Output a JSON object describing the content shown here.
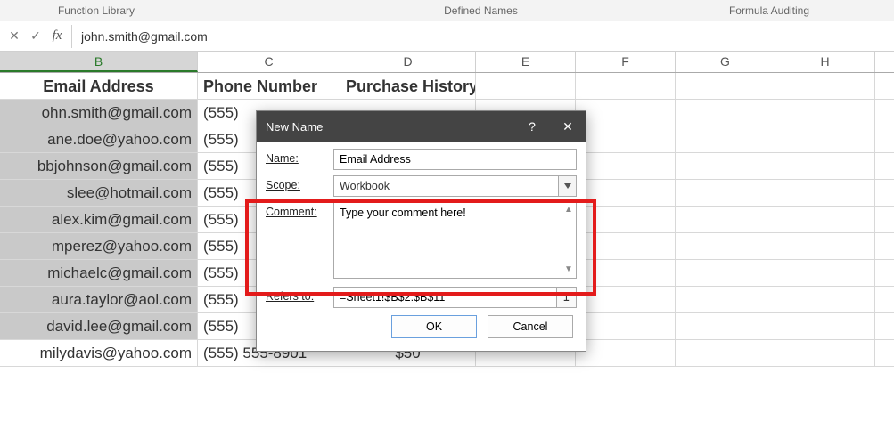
{
  "ribbon_groups": {
    "function_library": "Function Library",
    "defined_names": "Defined Names",
    "formula_auditing": "Formula Auditing"
  },
  "formula_bar": {
    "cancel_glyph": "✕",
    "accept_glyph": "✓",
    "fx_label": "fx",
    "value": "john.smith@gmail.com"
  },
  "columns": [
    "B",
    "C",
    "D",
    "E",
    "F",
    "G",
    "H"
  ],
  "selected_column": "B",
  "header_row": {
    "B": "Email Address",
    "C": "Phone Number",
    "D": "Purchase History"
  },
  "data_rows": [
    {
      "B": "ohn.smith@gmail.com",
      "C": "(555)",
      "D": ""
    },
    {
      "B": "ane.doe@yahoo.com",
      "C": "(555)",
      "D": ""
    },
    {
      "B": "bbjohnson@gmail.com",
      "C": "(555)",
      "D": ""
    },
    {
      "B": "slee@hotmail.com",
      "C": "(555)",
      "D": ""
    },
    {
      "B": "alex.kim@gmail.com",
      "C": "(555)",
      "D": ""
    },
    {
      "B": "mperez@yahoo.com",
      "C": "(555)",
      "D": ""
    },
    {
      "B": "michaelc@gmail.com",
      "C": "(555)",
      "D": ""
    },
    {
      "B": "aura.taylor@aol.com",
      "C": "(555)",
      "D": ""
    },
    {
      "B": "david.lee@gmail.com",
      "C": "(555)",
      "D": ""
    },
    {
      "B": "milydavis@yahoo.com",
      "C": "(555) 555-8901",
      "D": "$50"
    }
  ],
  "dialog": {
    "title": "New Name",
    "help_glyph": "?",
    "close_glyph": "✕",
    "labels": {
      "name": "Name:",
      "scope": "Scope:",
      "comment": "Comment:",
      "refers_to": "Refers to:"
    },
    "name_value": "Email Address",
    "scope_value": "Workbook",
    "comment_value": "Type your comment here!",
    "refers_to_value": "=Sheet1!$B$2:$B$11",
    "ok_label": "OK",
    "cancel_label": "Cancel"
  }
}
